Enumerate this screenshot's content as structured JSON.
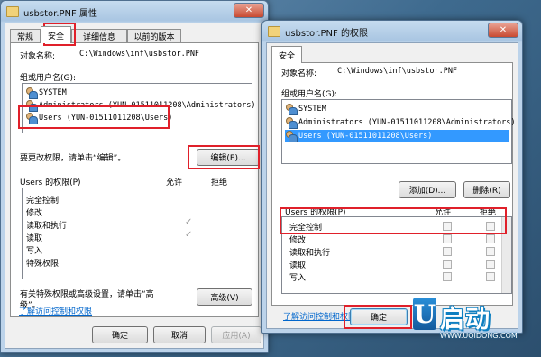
{
  "left_window": {
    "title": "usbstor.PNF 属性",
    "tabs": [
      "常规",
      "安全",
      "详细信息",
      "以前的版本"
    ],
    "object_label": "对象名称:",
    "object_value": "C:\\Windows\\inf\\usbstor.PNF",
    "group_label": "组或用户名(G):",
    "users": [
      "SYSTEM",
      "Administrators (YUN-01511011208\\Administrators)",
      "Users (YUN-01511011208\\Users)"
    ],
    "edit_hint": "要更改权限，请单击“编辑”。",
    "edit_button": "编辑(E)...",
    "perm_header": "Users 的权限(P)",
    "allow": "允许",
    "deny": "拒绝",
    "permissions": [
      "完全控制",
      "修改",
      "读取和执行",
      "读取",
      "写入",
      "特殊权限"
    ],
    "allowed_marks": [
      "✓",
      "✓"
    ],
    "special_hint": "有关特殊权限或高级设置，请单击“高级”。",
    "advanced_button": "高级(V)",
    "learn_link": "了解访问控制和权限",
    "ok": "确定",
    "cancel": "取消",
    "apply": "应用(A)"
  },
  "right_window": {
    "title": "usbstor.PNF 的权限",
    "tab": "安全",
    "object_label": "对象名称:",
    "object_value": "C:\\Windows\\inf\\usbstor.PNF",
    "group_label": "组或用户名(G):",
    "users": [
      "SYSTEM",
      "Administrators (YUN-01511011208\\Administrators)",
      "Users (YUN-01511011208\\Users)"
    ],
    "add_button": "添加(D)...",
    "remove_button": "删除(R)",
    "perm_header": "Users 的权限(P)",
    "allow": "允许",
    "deny": "拒绝",
    "permissions": [
      "完全控制",
      "修改",
      "读取和执行",
      "读取",
      "写入"
    ],
    "learn_link": "了解访问控制和权限",
    "ok": "确定"
  },
  "watermark": {
    "letter": "U",
    "brand": "启动",
    "url": "WWW.UQIDONG.COM"
  },
  "colors": {
    "highlight_box": "#e0202a",
    "selection": "#3399ff",
    "link": "#0066cc"
  }
}
